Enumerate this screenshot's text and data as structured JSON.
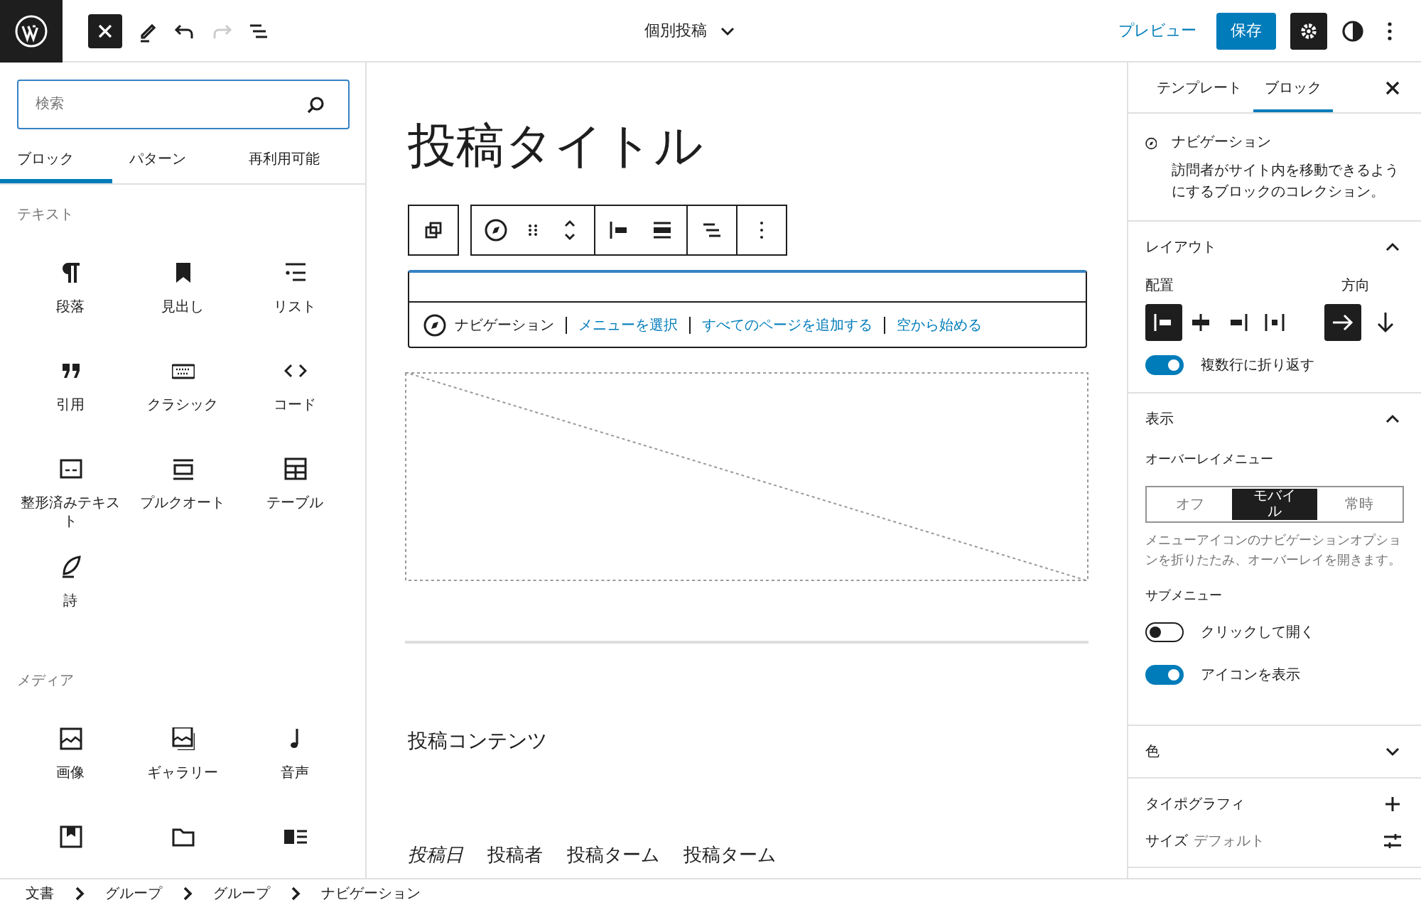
{
  "topbar": {
    "inserter_open": true,
    "redo_disabled": true,
    "document_title": "個別投稿",
    "preview": "プレビュー",
    "save": "保存",
    "settings_pressed": true
  },
  "inserter": {
    "search": {
      "placeholder": "検索"
    },
    "tabs": [
      {
        "label": "ブロック",
        "selected": true
      },
      {
        "label": "パターン",
        "selected": false
      },
      {
        "label": "再利用可能",
        "selected": false
      }
    ],
    "categories": [
      {
        "title": "テキスト",
        "blocks": [
          {
            "kind": "paragraph",
            "label": "段落"
          },
          {
            "kind": "heading",
            "label": "見出し"
          },
          {
            "kind": "list",
            "label": "リスト"
          },
          {
            "kind": "quote",
            "label": "引用"
          },
          {
            "kind": "classic",
            "label": "クラシック"
          },
          {
            "kind": "code",
            "label": "コード"
          },
          {
            "kind": "preformatted",
            "label": "整形済みテキスト"
          },
          {
            "kind": "pullquote",
            "label": "プルクオート"
          },
          {
            "kind": "table",
            "label": "テーブル"
          },
          {
            "kind": "verse",
            "label": "詩"
          }
        ]
      },
      {
        "title": "メディア",
        "blocks": [
          {
            "kind": "image",
            "label": "画像"
          },
          {
            "kind": "gallery",
            "label": "ギャラリー"
          },
          {
            "kind": "audio",
            "label": "音声"
          },
          {
            "kind": "cover"
          },
          {
            "kind": "file"
          },
          {
            "kind": "media-text"
          }
        ]
      }
    ]
  },
  "canvas": {
    "title": "投稿タイトル",
    "navigation": {
      "label": "ナビゲーション",
      "actions": [
        "メニューを選択",
        "すべてのページを追加する",
        "空から始める"
      ]
    },
    "content": "投稿コンテンツ",
    "meta": [
      {
        "kind": "date",
        "text": "投稿日"
      },
      {
        "kind": "author",
        "text": "投稿者"
      },
      {
        "kind": "terms",
        "text": "投稿ターム"
      },
      {
        "kind": "terms",
        "text": "投稿ターム"
      }
    ]
  },
  "sidebar": {
    "tabs": [
      {
        "label": "テンプレート",
        "selected": false
      },
      {
        "label": "ブロック",
        "selected": true
      }
    ],
    "block_card": {
      "title": "ナビゲーション",
      "description": "訪問者がサイト内を移動できるようにするブロックのコレクション。"
    },
    "panels": [
      {
        "kind": "layout",
        "title": "レイアウト",
        "expanded": true,
        "justification": {
          "label": "配置",
          "options": [
            {
              "kind": "left",
              "selected": true
            },
            {
              "kind": "center",
              "selected": false
            },
            {
              "kind": "right",
              "selected": false
            },
            {
              "kind": "space-between",
              "selected": false
            }
          ]
        },
        "orientation": {
          "label": "方向",
          "options": [
            {
              "kind": "horizontal",
              "selected": true
            },
            {
              "kind": "vertical",
              "selected": false
            }
          ]
        },
        "toggles": [
          {
            "label": "複数行に折り返す",
            "on": true
          }
        ]
      },
      {
        "kind": "display",
        "title": "表示",
        "expanded": true,
        "overlay_label": "オーバーレイメニュー",
        "overlay_options": [
          {
            "label": "オフ",
            "selected": false
          },
          {
            "label": "モバイル",
            "selected": true
          },
          {
            "label": "常時",
            "selected": false
          }
        ],
        "help": "メニューアイコンのナビゲーションオプションを折りたたみ、オーバーレイを開きます。",
        "submenu_label": "サブメニュー",
        "toggles": [
          {
            "label": "クリックして開く",
            "on": false
          },
          {
            "label": "アイコンを表示",
            "on": true
          }
        ]
      },
      {
        "kind": "color",
        "title": "色",
        "expanded": false
      },
      {
        "kind": "tools",
        "title": "タイポグラフィ",
        "rows": [
          {
            "label": "サイズ",
            "value": "デフォルト"
          }
        ]
      }
    ]
  },
  "breadcrumb": [
    "文書",
    "グループ",
    "グループ",
    "ナビゲーション"
  ]
}
